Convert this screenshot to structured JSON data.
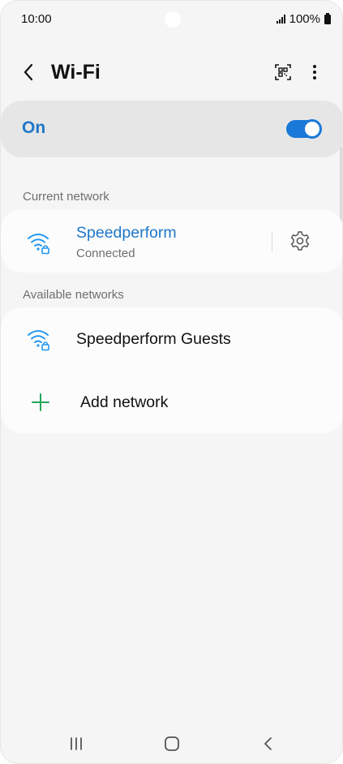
{
  "status_bar": {
    "time": "10:00",
    "battery": "100%",
    "icons": [
      "signal-icon",
      "battery-icon"
    ]
  },
  "header": {
    "title": "Wi-Fi",
    "icons": [
      "back-arrow-icon",
      "qr-code-icon",
      "more-options-icon"
    ]
  },
  "master_switch": {
    "label": "On",
    "state": "on",
    "accent": "#1979d8"
  },
  "current_network": {
    "section_label": "Current network",
    "name": "Speedperform",
    "status": "Connected",
    "icons": [
      "wifi-secured-icon",
      "gear-icon"
    ]
  },
  "available_networks": {
    "section_label": "Available networks",
    "items": [
      {
        "name": "Speedperform Guests",
        "icon": "wifi-secured-icon"
      }
    ],
    "add_label": "Add network",
    "add_icon": "plus-icon"
  },
  "nav_bar": {
    "icons": [
      "recent-apps-icon",
      "home-icon",
      "back-icon"
    ]
  },
  "colors": {
    "accent_text": "#1f77c9",
    "wifi_icon": "#2196f3",
    "add_icon": "#21a55a",
    "background": "#f5f5f5",
    "card": "#fcfcfc"
  }
}
